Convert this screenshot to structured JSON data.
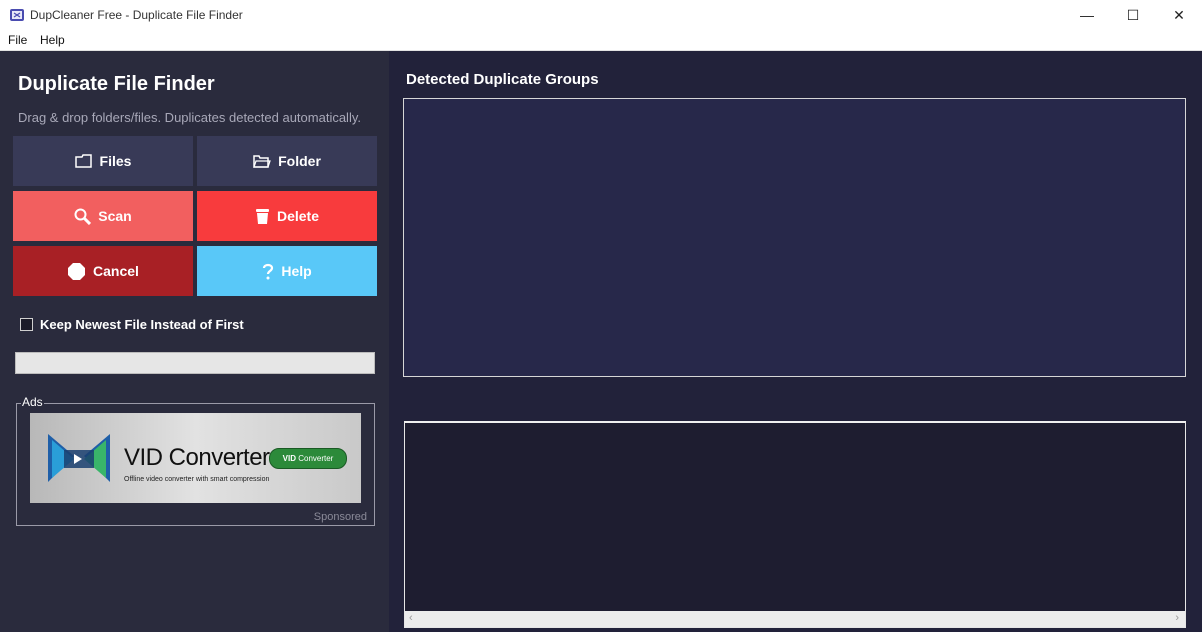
{
  "window": {
    "title": "DupCleaner Free - Duplicate File Finder",
    "controls": {
      "minimize": "—",
      "maximize": "☐",
      "close": "✕"
    }
  },
  "menu": {
    "items": [
      "File",
      "Help"
    ]
  },
  "left": {
    "title": "Duplicate File Finder",
    "subtitle": "Drag & drop folders/files. Duplicates detected automatically.",
    "buttons": [
      {
        "label": "Files",
        "icon": "folder-icon",
        "color": "#383a57"
      },
      {
        "label": "Folder",
        "icon": "open-folder-icon",
        "color": "#383a57"
      },
      {
        "label": "Scan",
        "icon": "magnifier-icon",
        "color": "#f25f5f"
      },
      {
        "label": "Delete",
        "icon": "trash-icon",
        "color": "#f83b3d"
      },
      {
        "label": "Cancel",
        "icon": "stop-icon",
        "color": "#a82025"
      },
      {
        "label": "Help",
        "icon": "question-icon",
        "color": "#59c8f8"
      }
    ],
    "checkbox": {
      "label": "Keep Newest File Instead of First",
      "checked": false
    },
    "progress": 0,
    "ads": {
      "label": "Ads",
      "banner_title": "VID Converter",
      "banner_tagline": "Offline video converter with smart compression",
      "banner_pill_a": "VID",
      "banner_pill_b": "Converter",
      "sponsored": "Sponsored"
    }
  },
  "right": {
    "title": "Detected Duplicate Groups",
    "scroll_left": "‹",
    "scroll_right": "›"
  },
  "colors": {
    "left_panel": "#2a2b3d",
    "right_panel": "#22223a",
    "groups_bg": "#27284a"
  }
}
